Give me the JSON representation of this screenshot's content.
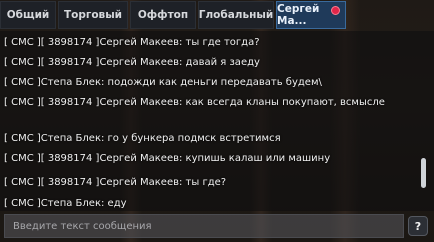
{
  "tabs": [
    {
      "label": "Общий"
    },
    {
      "label": "Торговый"
    },
    {
      "label": "Оффтоп"
    },
    {
      "label": "Глобальный"
    },
    {
      "label": "Сергей Ма...",
      "active": true,
      "has_notification": true
    }
  ],
  "messages": [
    "[ СМС ][ 3898174 ]Сергей Макеев: ты где тогда?",
    "[ СМС ][ 3898174 ]Сергей Макеев: давай я заеду",
    "[ СМС ]Степа Блек: подожди как деньги передавать будем\\",
    "[ СМС ][ 3898174 ]Сергей Макеев: как всегда кланы покупают, всмысле",
    "[ СМС ]Степа Блек: го у бункера подмск встретимся",
    "[ СМС ][ 3898174 ]Сергей Макеев: купишь калаш или машину",
    "[ СМС ][ 3898174 ]Сергей Макеев: ты где?",
    "[ СМС ]Степа Блек: еду"
  ],
  "input": {
    "placeholder": "Введите текст сообщения"
  },
  "help_button": {
    "label": "?"
  },
  "colors": {
    "active_tab": "#1f3a5a",
    "badge": "#e0264a",
    "text": "#f1f1f1"
  }
}
